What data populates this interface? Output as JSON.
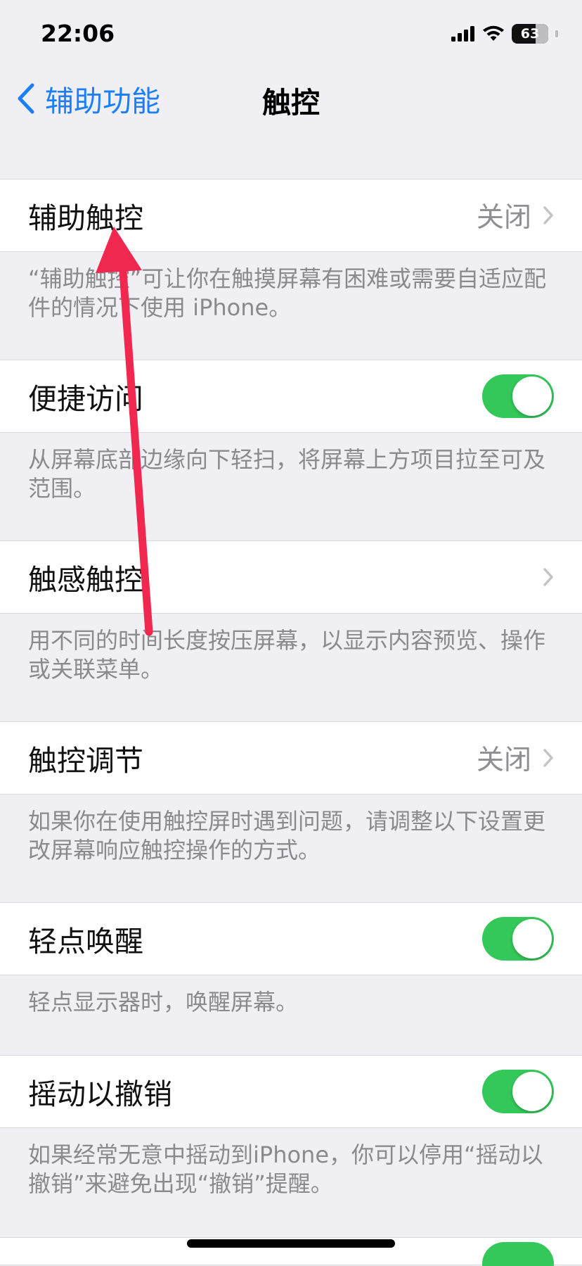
{
  "status": {
    "time": "22:06",
    "battery": "63",
    "icons": [
      "cellular-signal-icon",
      "wifi-icon",
      "battery-icon"
    ]
  },
  "nav": {
    "back_label": "辅助功能",
    "title": "触控"
  },
  "rows": [
    {
      "label": "辅助触控",
      "value": "关闭",
      "control": "disclosure",
      "footer": "“辅助触控”可让你在触摸屏幕有困难或需要自适应配件的情况下使用 iPhone。"
    },
    {
      "label": "便捷访问",
      "control": "toggle",
      "on": true,
      "footer": "从屏幕底部边缘向下轻扫，将屏幕上方项目拉至可及范围。"
    },
    {
      "label": "触感触控",
      "control": "disclosure",
      "footer": "用不同的时间长度按压屏幕，以显示内容预览、操作或关联菜单。"
    },
    {
      "label": "触控调节",
      "value": "关闭",
      "control": "disclosure",
      "footer": "如果你在使用触控屏时遇到问题，请调整以下设置更改屏幕响应触控操作的方式。"
    },
    {
      "label": "轻点唤醒",
      "control": "toggle",
      "on": true,
      "footer": "轻点显示器时，唤醒屏幕。"
    },
    {
      "label": "摇动以撤销",
      "control": "toggle",
      "on": true,
      "footer": "如果经常无意中摇动到iPhone，你可以停用“摇动以撤销”来避免出现“撤销”提醒。"
    }
  ],
  "colors": {
    "accent": "#1d7ff5",
    "toggle_on": "#34c759",
    "annotation_arrow": "#f0284f",
    "background": "#efeff4"
  }
}
